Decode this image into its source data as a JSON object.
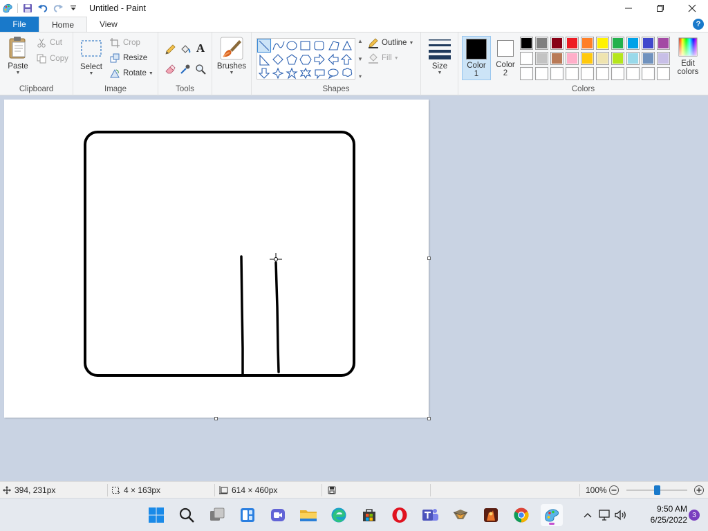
{
  "window": {
    "title": "Untitled - Paint",
    "minimize_icon": "minimize-icon",
    "maximize_icon": "restore-icon",
    "close_icon": "close-icon"
  },
  "quick_access": [
    "paint-app-icon",
    "save-icon",
    "undo-icon",
    "redo-icon",
    "customize-dropdown-icon"
  ],
  "tabs": [
    {
      "label": "File",
      "active": false
    },
    {
      "label": "Home",
      "active": true
    },
    {
      "label": "View",
      "active": false
    }
  ],
  "ribbon": {
    "clipboard": {
      "label": "Clipboard",
      "paste": "Paste",
      "cut": "Cut",
      "copy": "Copy"
    },
    "image": {
      "label": "Image",
      "select": "Select",
      "crop": "Crop",
      "resize": "Resize",
      "rotate": "Rotate"
    },
    "tools": {
      "label": "Tools",
      "items": [
        "pencil-icon",
        "fill-bucket-icon",
        "text-icon",
        "eraser-icon",
        "color-picker-icon",
        "magnifier-icon"
      ]
    },
    "brushes": {
      "label": "Brushes"
    },
    "shapes": {
      "label": "Shapes",
      "outline": "Outline",
      "fill": "Fill",
      "selected": "line"
    },
    "size": {
      "label": "Size"
    },
    "colors": {
      "label": "Colors",
      "color1_label_a": "Color",
      "color1_label_b": "1",
      "color2_label_a": "Color",
      "color2_label_b": "2",
      "edit_label_a": "Edit",
      "edit_label_b": "colors",
      "color1": "#000000",
      "color2": "#ffffff",
      "palette_row1": [
        "#000000",
        "#7f7f7f",
        "#880015",
        "#ed1c24",
        "#ff7f27",
        "#fff200",
        "#22b14c",
        "#00a2e8",
        "#3f48cc",
        "#a349a4"
      ],
      "palette_row2": [
        "#ffffff",
        "#c3c3c3",
        "#b97a57",
        "#ffaec9",
        "#ffc90e",
        "#efe4b0",
        "#b5e61d",
        "#99d9ea",
        "#7092be",
        "#c8bfe7"
      ],
      "palette_row3": [
        "#ffffff",
        "#ffffff",
        "#ffffff",
        "#ffffff",
        "#ffffff",
        "#ffffff",
        "#ffffff",
        "#ffffff",
        "#ffffff",
        "#ffffff"
      ]
    }
  },
  "status": {
    "cursor_pos": "394, 231px",
    "selection_size": "4 × 163px",
    "canvas_size": "614 × 460px",
    "zoom": "100%",
    "zoom_fraction": 0.5
  },
  "taskbar": {
    "icons": [
      "start-icon",
      "search-icon",
      "task-view-icon",
      "widgets-icon",
      "teams-meet-icon",
      "file-explorer-icon",
      "edge-icon",
      "store-icon",
      "opera-icon",
      "teams-icon",
      "app-icon",
      "game-icon",
      "chrome-icon",
      "paint-icon"
    ],
    "time": "9:50 AM",
    "date": "6/25/2022",
    "notifications": "3"
  }
}
